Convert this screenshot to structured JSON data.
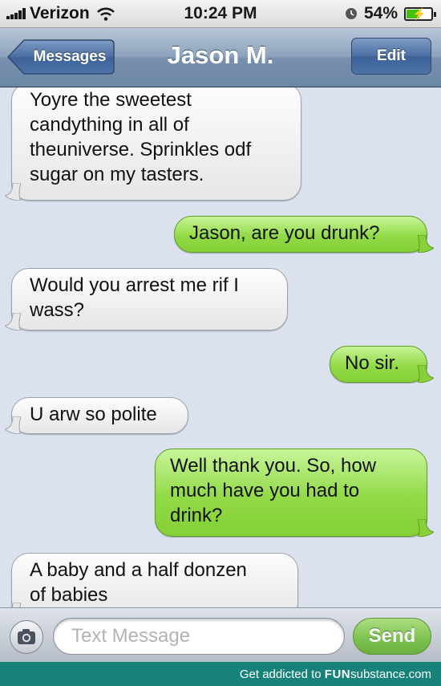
{
  "status_bar": {
    "carrier": "Verizon",
    "time": "10:24 PM",
    "battery_percent": "54%",
    "battery_level": 0.54,
    "icons": [
      "signal-bars-icon",
      "wifi-icon",
      "clock-icon",
      "battery-charging-icon"
    ]
  },
  "nav": {
    "back_label": "Messages",
    "title": "Jason M.",
    "edit_label": "Edit"
  },
  "messages": [
    {
      "from": "them",
      "lines": [
        "Yoyre the sweetest",
        "candything in all of",
        "theuniverse. Sprinkles odf",
        "sugar on my tasters."
      ]
    },
    {
      "from": "me",
      "lines": [
        "Jason, are you drunk?"
      ]
    },
    {
      "from": "them",
      "lines": [
        "Would you arrest me rif I",
        "wass?"
      ]
    },
    {
      "from": "me",
      "lines": [
        "No sir."
      ]
    },
    {
      "from": "them",
      "lines": [
        "U arw so polite"
      ]
    },
    {
      "from": "me",
      "lines": [
        "Well thank you. So, how",
        "much have you had to",
        "drink?"
      ]
    },
    {
      "from": "them",
      "lines": [
        "A baby and a half donzen",
        "of babies"
      ]
    }
  ],
  "input": {
    "placeholder": "Text Message",
    "send_label": "Send",
    "camera_icon": "camera-icon"
  },
  "footer": {
    "text_prefix": "Get addicted to",
    "brand_bold": "FUN",
    "brand_rest": "substance.com"
  },
  "colors": {
    "sent_bubble": "#92da48",
    "received_bubble": "#f0f0f0",
    "background": "#dbe2ed",
    "footer": "#17827a"
  }
}
